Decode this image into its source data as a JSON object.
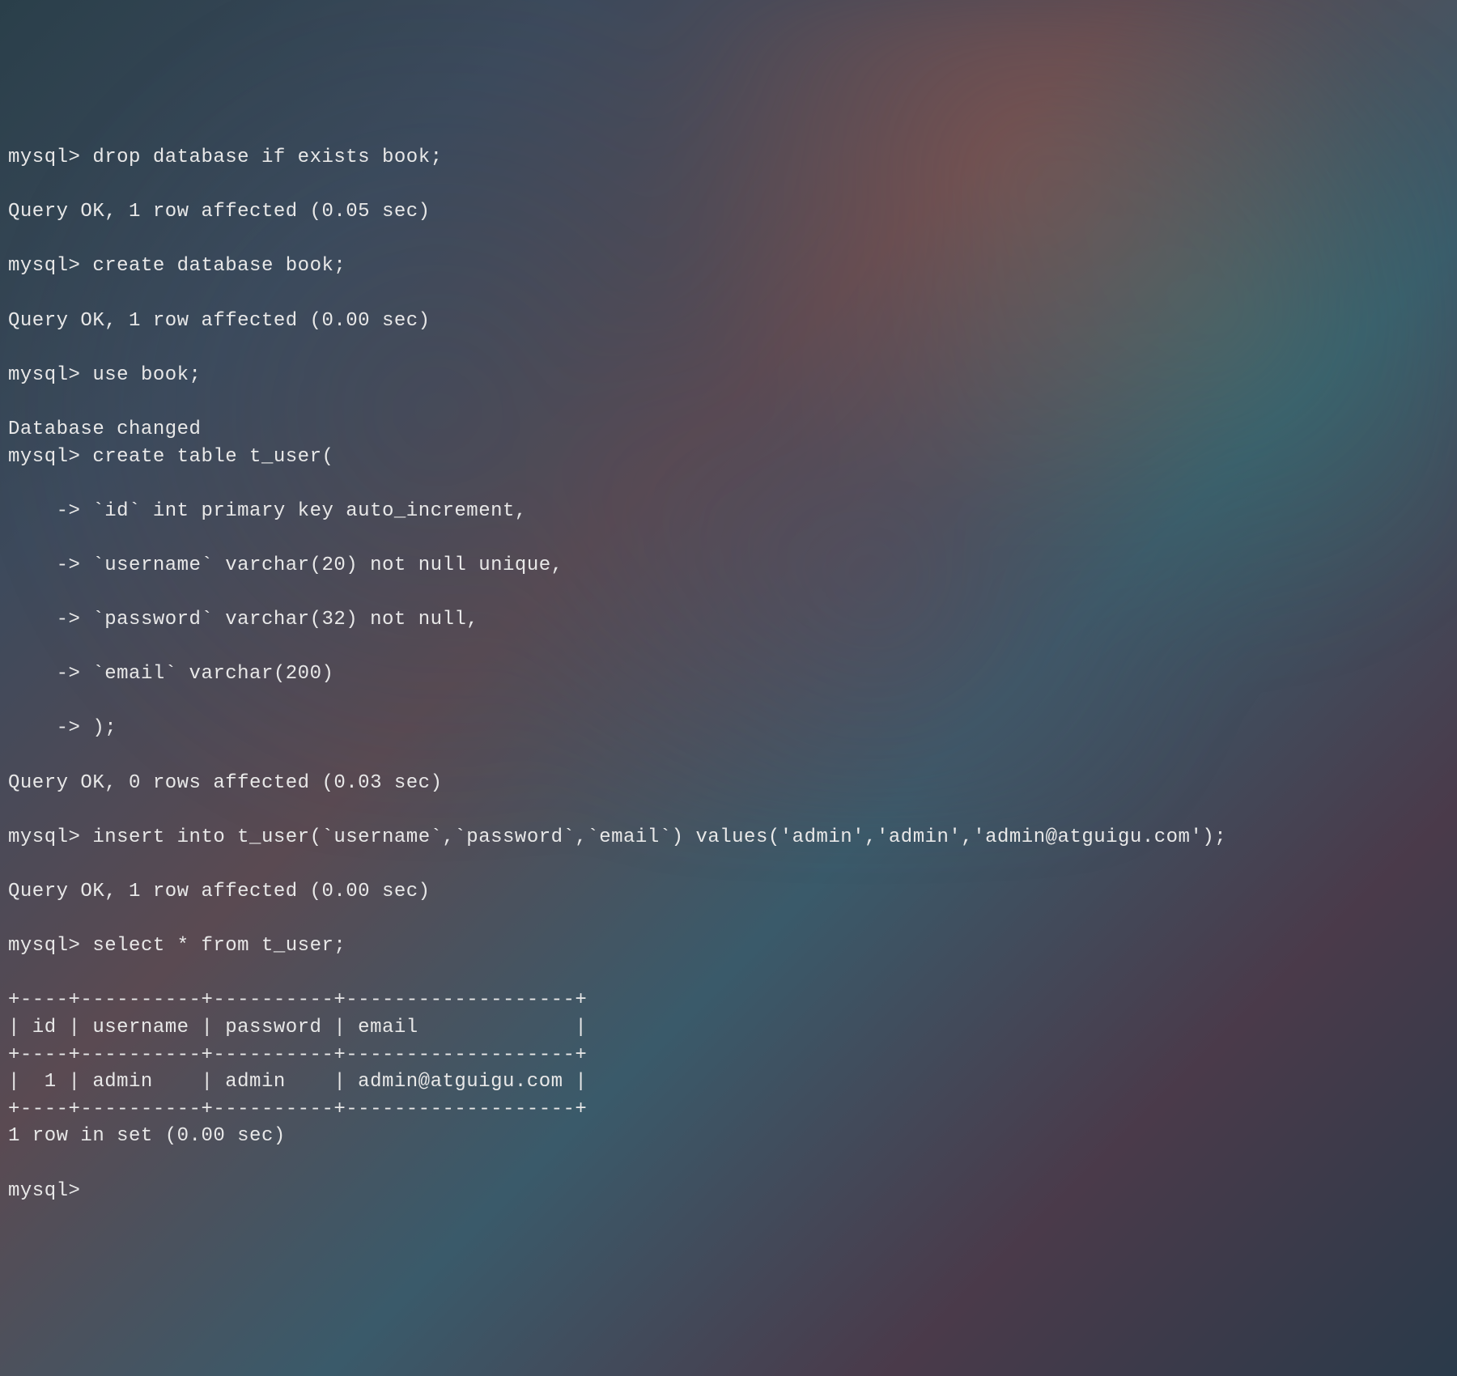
{
  "prompt": "mysql> ",
  "cont_prompt": "    -> ",
  "commands": {
    "drop_db": "drop database if exists book;",
    "drop_db_result": "Query OK, 1 row affected (0.05 sec)",
    "create_db": "create database book;",
    "create_db_result": "Query OK, 1 row affected (0.00 sec)",
    "use_db": "use book;",
    "use_db_result": "Database changed",
    "create_table": "create table t_user(",
    "create_table_l1": "`id` int primary key auto_increment,",
    "create_table_l2": "`username` varchar(20) not null unique,",
    "create_table_l3": "`password` varchar(32) not null,",
    "create_table_l4": "`email` varchar(200)",
    "create_table_l5": ");",
    "create_table_result": "Query OK, 0 rows affected (0.03 sec)",
    "insert": "insert into t_user(`username`,`password`,`email`) values('admin','admin','admin@atguigu.com');",
    "insert_result": "Query OK, 1 row affected (0.00 sec)",
    "select": "select * from t_user;",
    "table_border": "+----+----------+----------+-------------------+",
    "table_header": "| id | username | password | email             |",
    "table_row1": "|  1 | admin    | admin    | admin@atguigu.com |",
    "select_result": "1 row in set (0.00 sec)"
  },
  "blank": ""
}
